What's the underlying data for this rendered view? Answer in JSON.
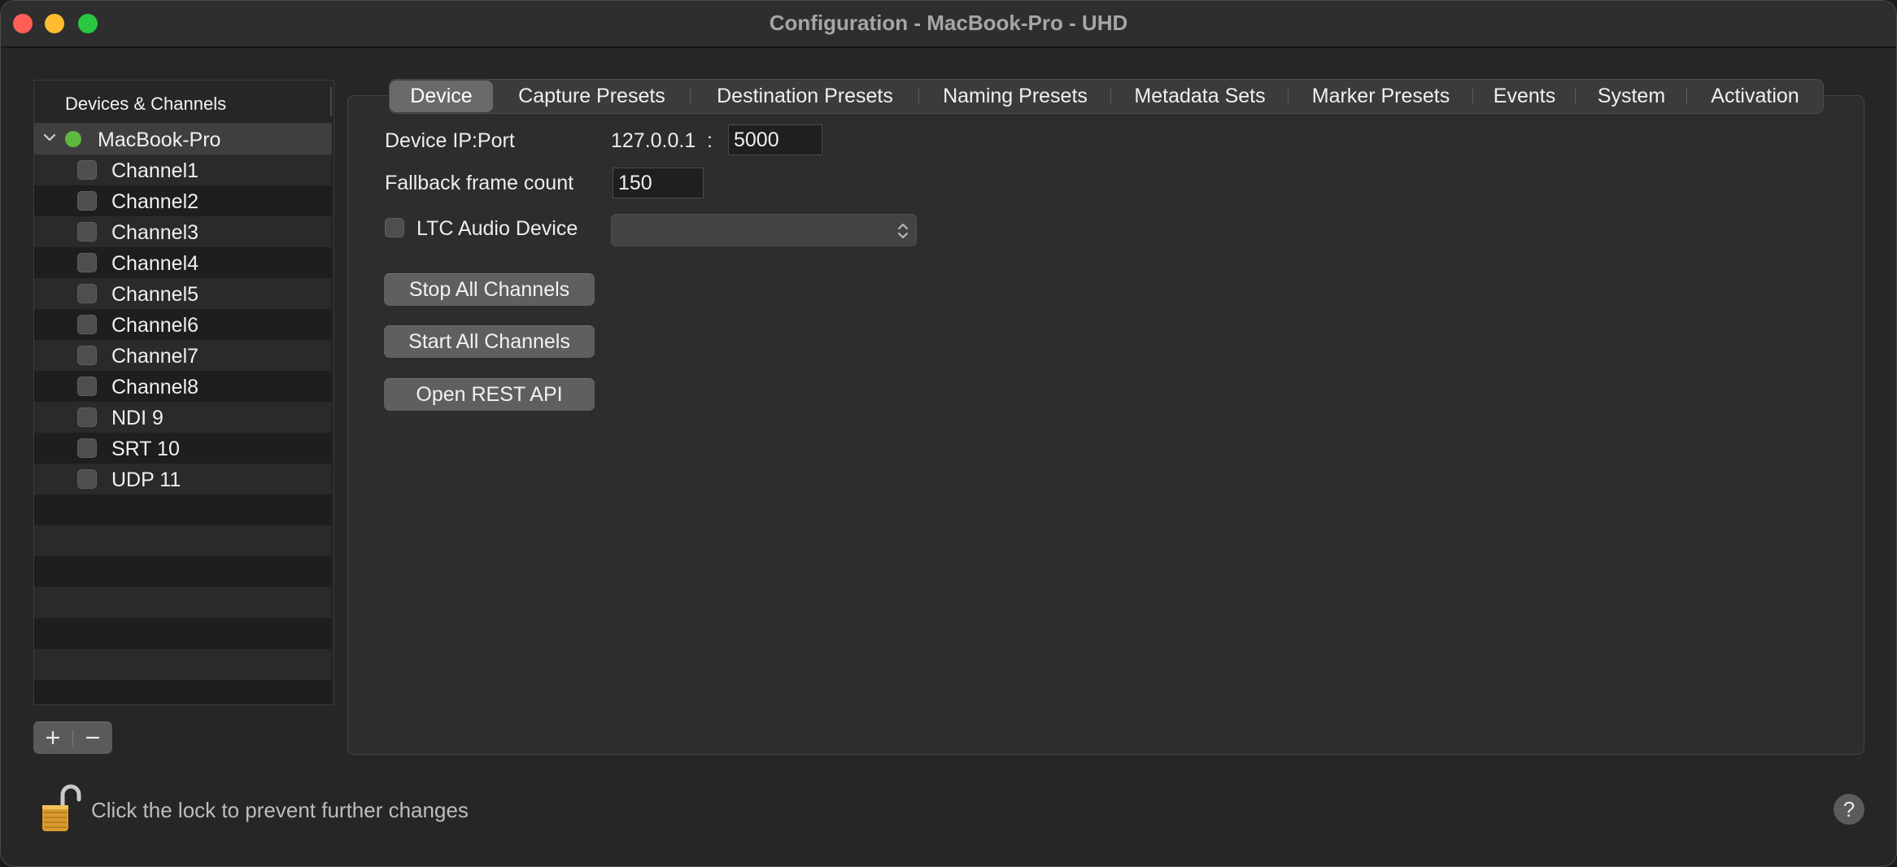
{
  "window": {
    "title": "Configuration - MacBook-Pro - UHD"
  },
  "sidebar": {
    "header": "Devices & Channels",
    "device": {
      "name": "MacBook-Pro",
      "status_color": "#5fb83f"
    },
    "channels": [
      {
        "label": "Channel1"
      },
      {
        "label": "Channel2"
      },
      {
        "label": "Channel3"
      },
      {
        "label": "Channel4"
      },
      {
        "label": "Channel5"
      },
      {
        "label": "Channel6"
      },
      {
        "label": "Channel7"
      },
      {
        "label": "Channel8"
      },
      {
        "label": "NDI 9"
      },
      {
        "label": "SRT 10"
      },
      {
        "label": "UDP 11"
      }
    ]
  },
  "tabs": [
    {
      "label": "Device",
      "active": true
    },
    {
      "label": "Capture Presets",
      "active": false
    },
    {
      "label": "Destination Presets",
      "active": false
    },
    {
      "label": "Naming Presets",
      "active": false
    },
    {
      "label": "Metadata Sets",
      "active": false
    },
    {
      "label": "Marker Presets",
      "active": false
    },
    {
      "label": "Events",
      "active": false
    },
    {
      "label": "System",
      "active": false
    },
    {
      "label": "Activation",
      "active": false
    }
  ],
  "device_tab": {
    "ip_port_label": "Device IP:Port",
    "ip": "127.0.0.1",
    "colon": ":",
    "port": "5000",
    "fallback_label": "Fallback frame count",
    "fallback_value": "150",
    "ltc_label": "LTC Audio Device",
    "ltc_value": "",
    "buttons": {
      "stop": "Stop All Channels",
      "start": "Start All Channels",
      "rest": "Open REST API"
    }
  },
  "footer": {
    "lock_text": "Click the lock to prevent further changes",
    "help": "?"
  },
  "colors": {
    "accent_green": "#5fb83f",
    "window_bg": "#262626"
  }
}
